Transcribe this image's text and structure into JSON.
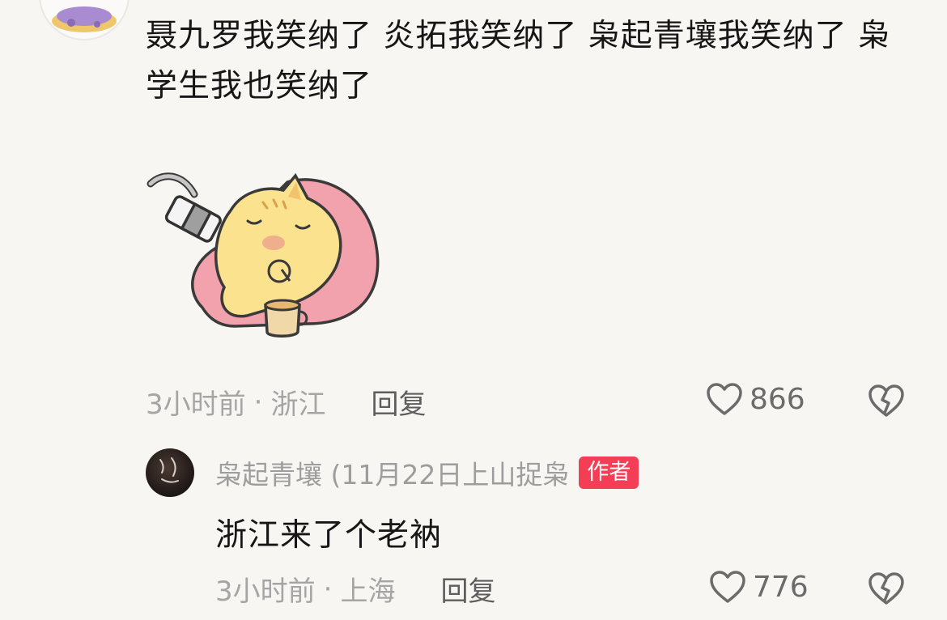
{
  "comment": {
    "text": "聂九罗我笑纳了 炎拓我笑纳了 枭起青壤我笑纳了 枭学生我也笑纳了",
    "time": "3小时前",
    "separator": "·",
    "location": "浙江",
    "reply_label": "回复",
    "likes": "866",
    "sticker_icon": "sleepy-cat-sticker"
  },
  "reply": {
    "author": "枭起青壤 (11月22日上山捉枭",
    "badge": "作者",
    "text": "浙江来了个老衲",
    "time": "3小时前",
    "separator": "·",
    "location": "上海",
    "reply_label": "回复",
    "likes": "776"
  },
  "icons": {
    "like": "heart-outline-icon",
    "dislike": "broken-heart-icon"
  },
  "colors": {
    "badge": "#f33e56",
    "background": "#f7f6f3",
    "text": "#161616",
    "meta": "#a5a5a5"
  }
}
